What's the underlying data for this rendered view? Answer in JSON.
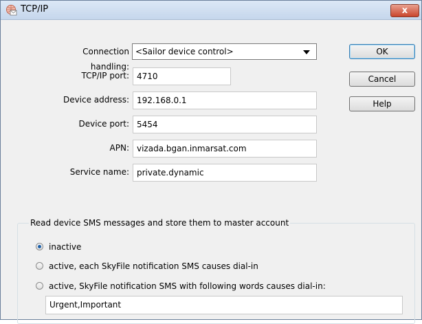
{
  "window": {
    "title": "TCP/IP",
    "close_label": "x"
  },
  "form": {
    "connection_handling": {
      "label": "Connection handling:",
      "value": "<Sailor device control>"
    },
    "tcp_port": {
      "label": "TCP/IP port:",
      "value": "4710"
    },
    "device_address": {
      "label": "Device address:",
      "value": "192.168.0.1"
    },
    "device_port": {
      "label": "Device port:",
      "value": "5454"
    },
    "apn": {
      "label": "APN:",
      "value": "vizada.bgan.inmarsat.com"
    },
    "service_name": {
      "label": "Service name:",
      "value": "private.dynamic"
    }
  },
  "buttons": {
    "ok": "OK",
    "cancel": "Cancel",
    "help": "Help"
  },
  "sms_group": {
    "title": "Read device SMS messages and store them to master account",
    "options": [
      {
        "label": "inactive",
        "checked": true
      },
      {
        "label": "active, each SkyFile notification SMS causes dial-in",
        "checked": false
      },
      {
        "label": "active, SkyFile notification SMS with following words causes dial-in:",
        "checked": false
      }
    ],
    "words_value": "Urgent,Important"
  },
  "icons": {
    "title_icon": "network-email-icon",
    "close_icon": "close-icon",
    "dropdown_icon": "chevron-down-icon"
  }
}
